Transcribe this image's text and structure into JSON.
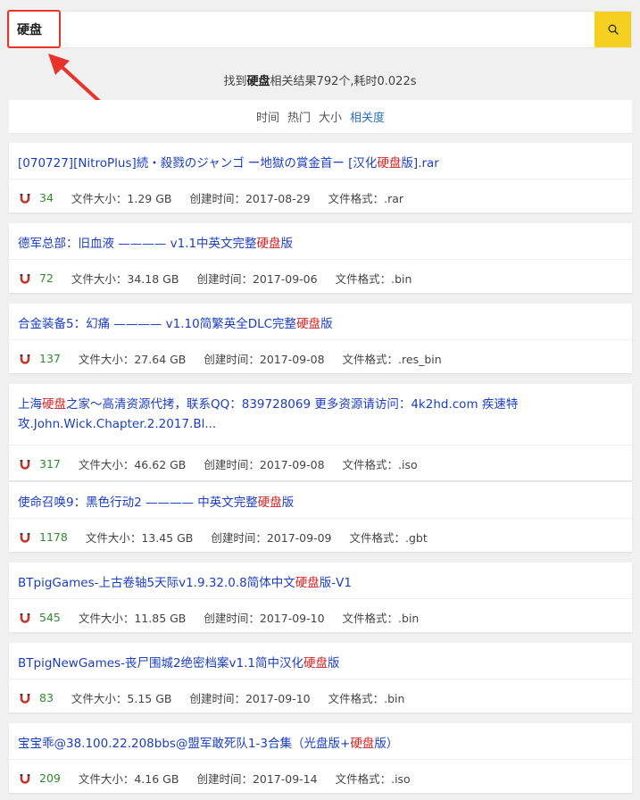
{
  "search": {
    "value": "硬盘",
    "button_icon": "search-icon"
  },
  "summary": {
    "prefix": "找到",
    "keyword": "硬盘",
    "suffix": "相关结果792个,耗时0.022s"
  },
  "sort": {
    "options": [
      "时间",
      "热门",
      "大小",
      "相关度"
    ],
    "active": "相关度"
  },
  "labels": {
    "size": "文件大小：",
    "created": "创建时间：",
    "format": "文件格式："
  },
  "colors": {
    "accent": "#f5d020",
    "link": "#1a3dc2",
    "highlight": "#d21f1f",
    "count": "#2e8b2e",
    "annotation": "#e8332a"
  },
  "results": [
    {
      "title_parts": [
        "[070727][NitroPlus]続・殺戮のジャンゴ ー地獄の賞金首ー [汉化",
        "硬盘",
        "版].rar"
      ],
      "count": "34",
      "size": "1.29 GB",
      "created": "2017-08-29",
      "format": ".rar"
    },
    {
      "title_parts": [
        "德军总部：旧血液 ———— v1.1中英文完整",
        "硬盘",
        "版"
      ],
      "count": "72",
      "size": "34.18 GB",
      "created": "2017-09-06",
      "format": ".bin"
    },
    {
      "title_parts": [
        "合金装备5：幻痛 ———— v1.10简繁英全DLC完整",
        "硬盘",
        "版"
      ],
      "count": "137",
      "size": "27.64 GB",
      "created": "2017-09-08",
      "format": ".res_bin"
    },
    {
      "title_parts": [
        "上海",
        "硬盘",
        "之家～高清资源代拷，联系QQ：839728069 更多资源请访问：4k2hd.com 疾速特攻.John.Wick.Chapter.2.2017.Bl..."
      ],
      "count": "317",
      "size": "46.62 GB",
      "created": "2017-09-08",
      "format": ".iso"
    },
    {
      "title_parts": [
        "使命召唤9：黑色行动2 ———— 中英文完整",
        "硬盘",
        "版"
      ],
      "count": "1178",
      "size": "13.45 GB",
      "created": "2017-09-09",
      "format": ".gbt"
    },
    {
      "title_parts": [
        "BTpigGames-上古卷轴5天际v1.9.32.0.8简体中文",
        "硬盘",
        "版-V1"
      ],
      "count": "545",
      "size": "11.85 GB",
      "created": "2017-09-10",
      "format": ".bin"
    },
    {
      "title_parts": [
        "BTpigNewGames-丧尸围城2绝密档案v1.1简中汉化",
        "硬盘",
        "版"
      ],
      "count": "83",
      "size": "5.15 GB",
      "created": "2017-09-10",
      "format": ".bin"
    },
    {
      "title_parts": [
        "宝宝乖@38.100.22.208bbs@盟军敢死队1-3合集（光盘版+",
        "硬盘",
        "版）"
      ],
      "count": "209",
      "size": "4.16 GB",
      "created": "2017-09-14",
      "format": ".iso"
    }
  ]
}
